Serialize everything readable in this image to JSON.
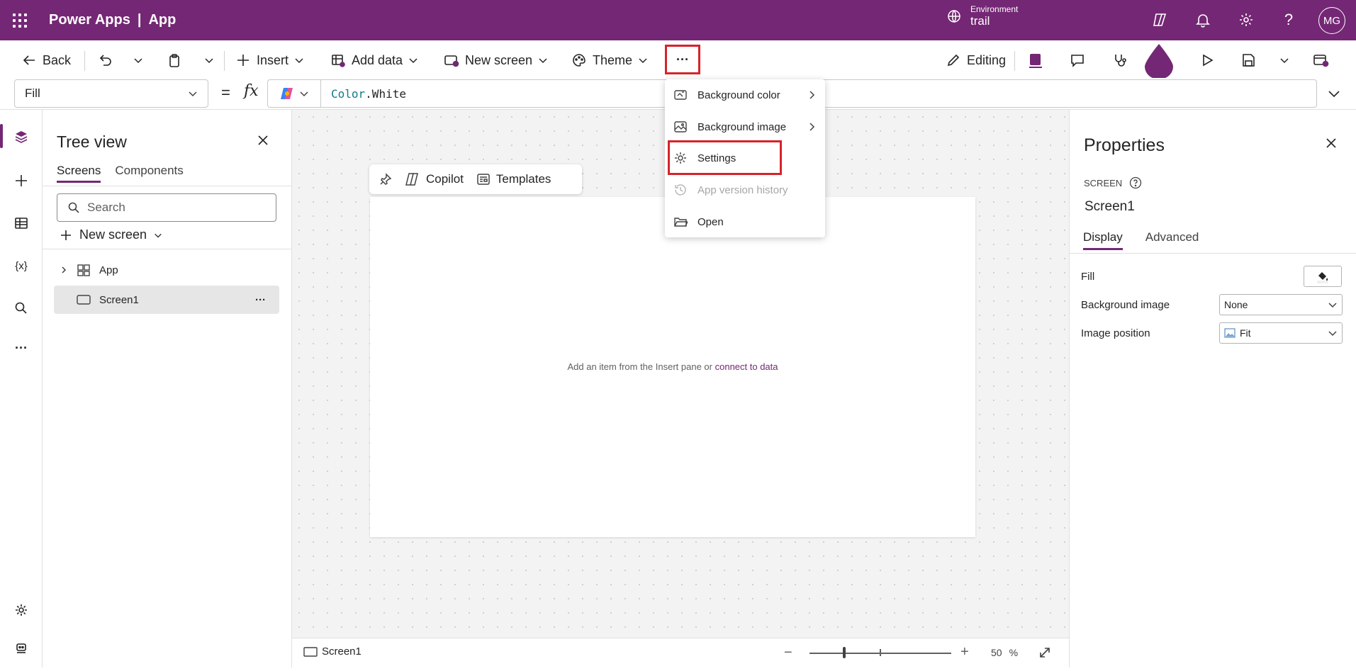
{
  "topbar": {
    "brand_primary": "Power Apps",
    "brand_separator": "|",
    "brand_app": "App",
    "environment_label": "Environment",
    "environment_value": "trail",
    "avatar_initials": "MG",
    "bg_color": "#742774"
  },
  "command_bar": {
    "back_label": "Back",
    "insert_label": "Insert",
    "add_data_label": "Add data",
    "new_screen_label": "New screen",
    "theme_label": "Theme",
    "more_label": "···",
    "editing_label": "Editing"
  },
  "formula_bar": {
    "property": "Fill",
    "equals": "=",
    "fx": "fx",
    "formula_keyword": "Color",
    "formula_rest": ".White"
  },
  "more_menu": {
    "items": [
      {
        "label": "Background color",
        "icon": "background-color-icon",
        "has_submenu": true,
        "disabled": false
      },
      {
        "label": "Background image",
        "icon": "image-icon",
        "has_submenu": true,
        "disabled": false
      },
      {
        "label": "Settings",
        "icon": "gear-icon",
        "has_submenu": false,
        "disabled": false
      },
      {
        "label": "App version history",
        "icon": "history-icon",
        "has_submenu": false,
        "disabled": true
      },
      {
        "label": "Open",
        "icon": "folder-icon",
        "has_submenu": false,
        "disabled": false
      }
    ]
  },
  "tree_view": {
    "title": "Tree view",
    "tabs": [
      "Screens",
      "Components"
    ],
    "search_placeholder": "Search",
    "new_screen_label": "New screen",
    "nodes": [
      {
        "label": "App"
      },
      {
        "label": "Screen1"
      }
    ],
    "node_more": "···"
  },
  "canvas": {
    "mini_toolbar": {
      "copilot_label": "Copilot",
      "templates_label": "Templates"
    },
    "empty_message_prefix": "Add an item from the Insert pane",
    "empty_message_or": "or",
    "empty_message_link": "connect to data"
  },
  "status_bar": {
    "screen_name": "Screen1",
    "zoom_minus": "−",
    "zoom_plus": "+",
    "zoom_value": "50",
    "zoom_unit": "%"
  },
  "properties": {
    "title": "Properties",
    "kind": "SCREEN",
    "name": "Screen1",
    "tabs": [
      "Display",
      "Advanced"
    ],
    "rows": {
      "fill_label": "Fill",
      "background_image_label": "Background image",
      "background_image_value": "None",
      "image_position_label": "Image position",
      "image_position_value": "Fit"
    }
  },
  "colors": {
    "accent": "#742774",
    "highlight": "#d6232a"
  }
}
